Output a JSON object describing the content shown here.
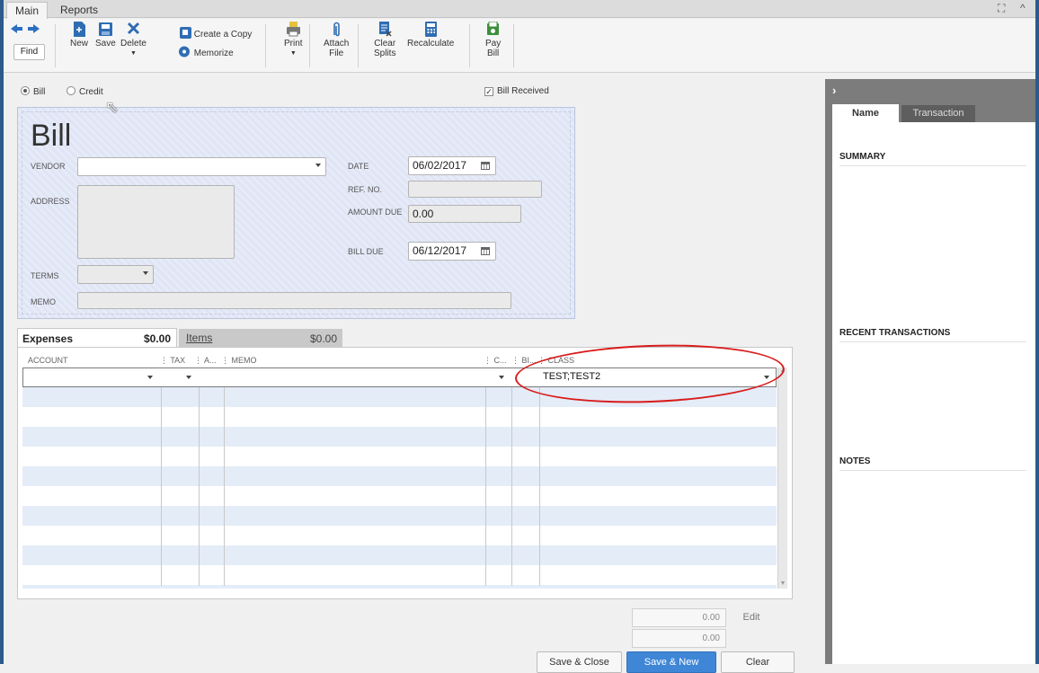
{
  "tabs": [
    "Main",
    "Reports"
  ],
  "window_controls": {
    "expand": "⛶",
    "collapse": "^"
  },
  "toolbar": {
    "find": "Find",
    "new": "New",
    "save": "Save",
    "delete": "Delete",
    "create_copy": "Create a Copy",
    "memorize": "Memorize",
    "print": "Print",
    "attach_1": "Attach",
    "attach_2": "File",
    "clear_1": "Clear",
    "clear_2": "Splits",
    "recalculate": "Recalculate",
    "pay_1": "Pay",
    "pay_2": "Bill"
  },
  "options": {
    "bill": "Bill",
    "credit": "Credit",
    "bill_received": "Bill Received"
  },
  "form": {
    "title": "Bill",
    "vendor_label": "VENDOR",
    "address_label": "ADDRESS",
    "terms_label": "TERMS",
    "memo_label": "MEMO",
    "date_label": "DATE",
    "date": "06/02/2017",
    "refno_label": "REF. NO.",
    "amount_due_label": "AMOUNT DUE",
    "amount_due": "0.00",
    "bill_due_label": "BILL DUE",
    "bill_due": "06/12/2017"
  },
  "grid_tabs": {
    "expenses": "Expenses",
    "expenses_amount": "$0.00",
    "items": "Items",
    "items_amount": "$0.00"
  },
  "columns": {
    "account": "ACCOUNT",
    "tax": "TAX",
    "amount": "A...",
    "memo": "MEMO",
    "customer": "C...",
    "billable": "BI...",
    "class": "CLASS"
  },
  "first_row": {
    "class": "TEST;TEST2"
  },
  "totals": {
    "expenses_total": "0.00",
    "edit": "Edit",
    "items_total": "0.00"
  },
  "buttons": {
    "save_close": "Save & Close",
    "save_new": "Save & New",
    "clear": "Clear"
  },
  "panel": {
    "tab_name": "Name",
    "tab_transaction": "Transaction",
    "summary": "SUMMARY",
    "recent": "RECENT TRANSACTIONS",
    "notes": "NOTES"
  },
  "colors": {
    "accent": "#3f86d6",
    "annotation": "#d81c1c",
    "panel": "#7c7c7c"
  }
}
